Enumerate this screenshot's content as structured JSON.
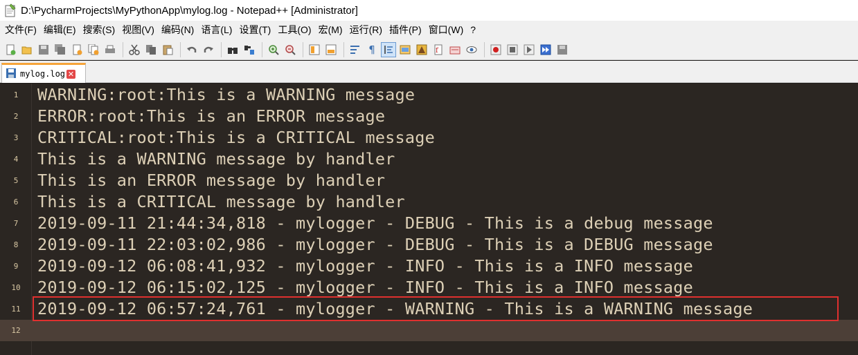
{
  "window": {
    "title": "D:\\PycharmProjects\\MyPythonApp\\mylog.log - Notepad++ [Administrator]"
  },
  "menu": {
    "items": [
      "文件(F)",
      "编辑(E)",
      "搜索(S)",
      "视图(V)",
      "编码(N)",
      "语言(L)",
      "设置(T)",
      "工具(O)",
      "宏(M)",
      "运行(R)",
      "插件(P)",
      "窗口(W)",
      "?"
    ]
  },
  "toolbar": {
    "icons": [
      "new-file-icon",
      "open-file-icon",
      "save-icon",
      "save-all-icon",
      "close-icon",
      "close-all-icon",
      "print-icon",
      "cut-icon",
      "copy-icon",
      "paste-icon",
      "undo-icon",
      "redo-icon",
      "find-icon",
      "replace-icon",
      "zoom-in-icon",
      "zoom-out-icon",
      "sync-vertical-icon",
      "sync-horizontal-icon",
      "word-wrap-icon",
      "show-all-chars-icon",
      "indent-guide-icon",
      "lang-udl-icon",
      "doc-map-icon",
      "function-list-icon",
      "folder-workspace-icon",
      "monitoring-icon",
      "record-macro-icon",
      "stop-macro-icon",
      "play-macro-icon",
      "run-macro-multiple-icon",
      "save-macro-icon"
    ]
  },
  "tab": {
    "label": "mylog.log",
    "close_glyph": "✕"
  },
  "editor": {
    "lines": [
      {
        "num": "1",
        "text": "WARNING:root:This is a WARNING message"
      },
      {
        "num": "2",
        "text": "ERROR:root:This is an ERROR message"
      },
      {
        "num": "3",
        "text": "CRITICAL:root:This is a CRITICAL message"
      },
      {
        "num": "4",
        "text": "This is a WARNING message by handler"
      },
      {
        "num": "5",
        "text": "This is an ERROR message by handler"
      },
      {
        "num": "6",
        "text": "This is a CRITICAL message by handler"
      },
      {
        "num": "7",
        "text": "2019-09-11 21:44:34,818 - mylogger - DEBUG - This is a debug message"
      },
      {
        "num": "8",
        "text": "2019-09-11 22:03:02,986 - mylogger - DEBUG - This is a DEBUG message"
      },
      {
        "num": "9",
        "text": "2019-09-12 06:08:41,932 - mylogger - INFO - This is a INFO message"
      },
      {
        "num": "10",
        "text": "2019-09-12 06:15:02,125 - mylogger - INFO - This is a INFO message"
      },
      {
        "num": "11",
        "text": "2019-09-12 06:57:24,761 - mylogger - WARNING - This is a WARNING message"
      },
      {
        "num": "12",
        "text": ""
      }
    ],
    "highlighted_line": 11,
    "current_line": 12
  },
  "colors": {
    "editor_bg": "#2b2622",
    "text": "#ddd0b6",
    "line_number": "#d8c7a3",
    "current_line_bg": "#4c3f37",
    "annotation_box": "#e0302f",
    "tab_accent": "#f6a43a"
  }
}
